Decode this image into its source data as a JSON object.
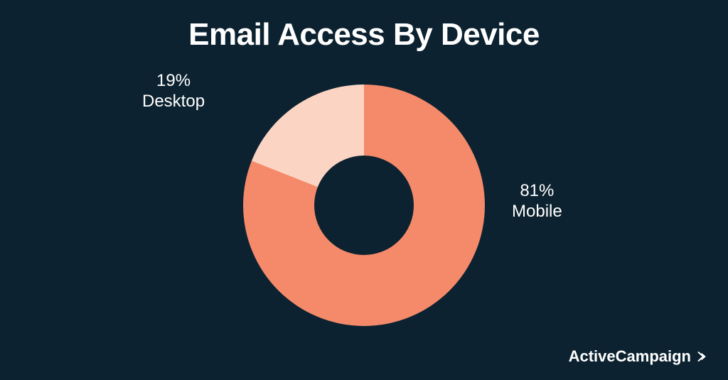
{
  "title": "Email Access By Device",
  "brand": "ActiveCampaign",
  "colors": {
    "bg": "#0c2230",
    "primary": "#f48a6a",
    "secondary": "#fbd4c3",
    "text": "#ffffff"
  },
  "labels": {
    "desktop_pct": "19%",
    "desktop_name": "Desktop",
    "mobile_pct": "81%",
    "mobile_name": "Mobile"
  },
  "chart_data": {
    "type": "pie",
    "title": "Email Access By Device",
    "series": [
      {
        "name": "Mobile",
        "value": 81,
        "color": "#f48a6a"
      },
      {
        "name": "Desktop",
        "value": 19,
        "color": "#fbd4c3"
      }
    ]
  }
}
